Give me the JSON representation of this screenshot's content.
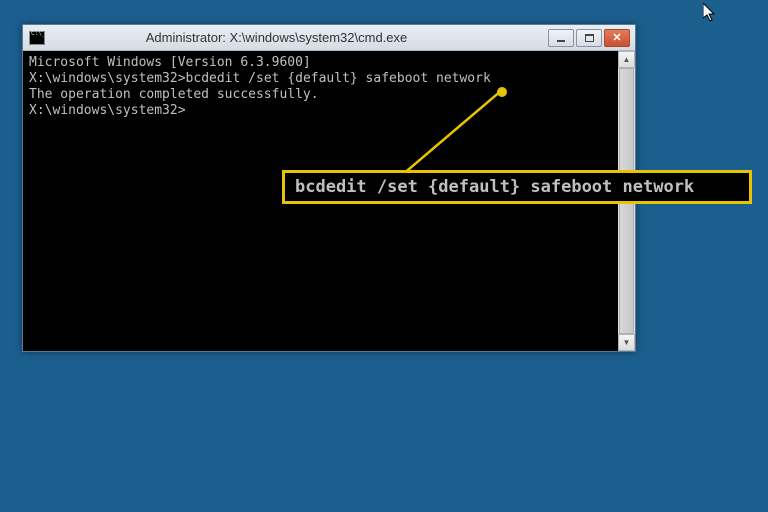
{
  "window": {
    "title": "Administrator: X:\\windows\\system32\\cmd.exe"
  },
  "terminal": {
    "line1": "Microsoft Windows [Version 6.3.9600]",
    "blank1": "",
    "prompt1_path": "X:\\windows\\system32>",
    "prompt1_cmd": "bcdedit /set {default} safeboot network",
    "result": "The operation completed successfully.",
    "blank2": "",
    "prompt2_path": "X:\\windows\\system32>"
  },
  "callout": {
    "text": "bcdedit /set {default} safeboot network"
  },
  "controls": {
    "minimize": "minimize",
    "maximize": "maximize",
    "close": "close"
  }
}
